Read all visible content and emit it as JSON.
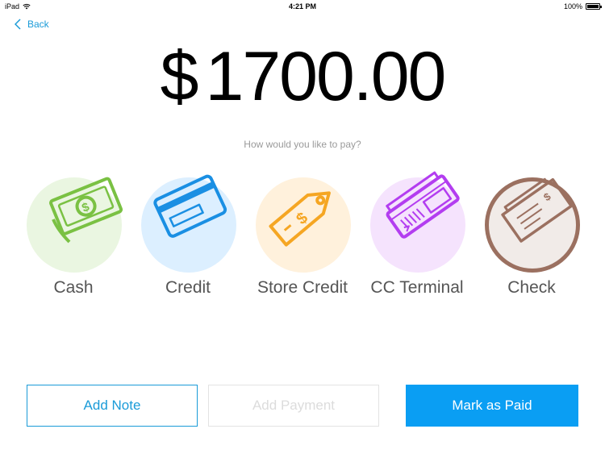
{
  "status_bar": {
    "device": "iPad",
    "time": "4:21 PM",
    "battery": "100%",
    "battery_level": 1.0
  },
  "nav": {
    "back_label": "Back"
  },
  "amount": {
    "currency": "$",
    "value": "1700.00"
  },
  "prompt": "How would you like to pay?",
  "methods": [
    {
      "label": "Cash",
      "icon": "cash-icon",
      "color": "#7ac143",
      "bg": "#eaf6e1"
    },
    {
      "label": "Credit",
      "icon": "credit-card-icon",
      "color": "#1a8fe3",
      "bg": "#dcefff"
    },
    {
      "label": "Store Credit",
      "icon": "price-tag-icon",
      "color": "#f5a623",
      "bg": "#fff1dc"
    },
    {
      "label": "CC Terminal",
      "icon": "card-terminal-icon",
      "color": "#b33df0",
      "bg": "#f5e3fd"
    },
    {
      "label": "Check",
      "icon": "check-icon",
      "color": "#9b7060",
      "bg": "#f1ebe8"
    }
  ],
  "actions": {
    "add_note": "Add Note",
    "add_payment": "Add Payment",
    "mark_paid": "Mark as Paid"
  }
}
